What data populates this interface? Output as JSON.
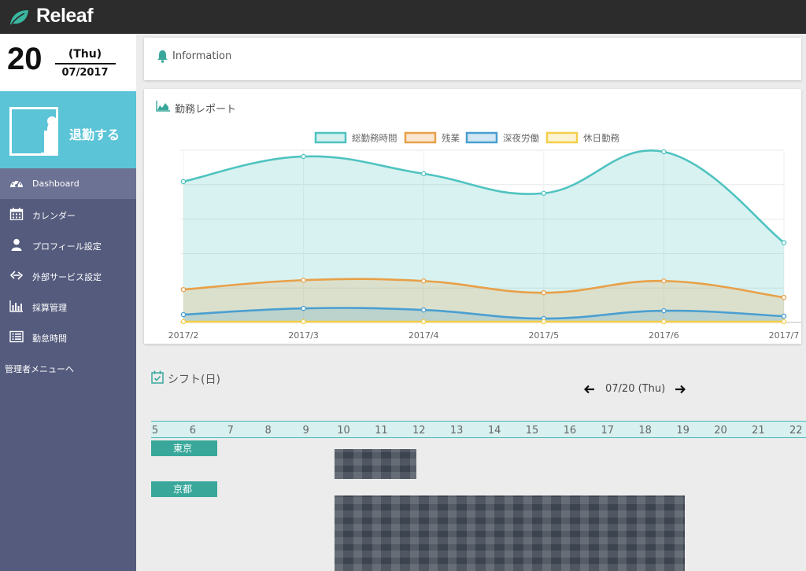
{
  "app": {
    "name": "Releaf"
  },
  "colors": {
    "topbar": "#2c2c2c",
    "sidebar": "#545b7d",
    "sidebar_active": "#6c7293",
    "accent": "#5bc4d6",
    "teal": "#39a89b"
  },
  "date": {
    "day": "20",
    "weekday": "(Thu)",
    "month_year": "07/2017"
  },
  "clock_button": {
    "label": "退勤する",
    "icon": "clock-card-icon"
  },
  "nav": {
    "items": [
      {
        "label": "Dashboard",
        "icon": "dashboard-icon",
        "active": true
      },
      {
        "label": "カレンダー",
        "icon": "calendar-icon",
        "active": false
      },
      {
        "label": "プロフィール設定",
        "icon": "user-icon",
        "active": false
      },
      {
        "label": "外部サービス設定",
        "icon": "link-icon",
        "active": false
      },
      {
        "label": "採算管理",
        "icon": "bar-chart-icon",
        "active": false
      },
      {
        "label": "勤怠時間",
        "icon": "list-icon",
        "active": false
      }
    ],
    "admin_link": "管理者メニューへ"
  },
  "info": {
    "title": "Information",
    "icon": "bell-icon"
  },
  "report": {
    "title": "勤務レポート",
    "icon": "area-chart-icon"
  },
  "chart_data": {
    "type": "area",
    "title": "",
    "x": [
      "2017/2",
      "2017/3",
      "2017/4",
      "2017/5",
      "2017/6",
      "2017/7"
    ],
    "ylim": [
      0,
      220
    ],
    "grid": true,
    "legend_position": "top",
    "series": [
      {
        "name": "総勤務時間",
        "color": "#4fc3c0",
        "values": [
          180,
          212,
          190,
          165,
          218,
          102
        ]
      },
      {
        "name": "残業",
        "color": "#e8a048",
        "values": [
          42,
          54,
          53,
          38,
          53,
          32
        ]
      },
      {
        "name": "深夜労働",
        "color": "#4a9fd0",
        "values": [
          10,
          18,
          16,
          5,
          15,
          8
        ]
      },
      {
        "name": "休日勤務",
        "color": "#f5cf4a",
        "values": [
          1,
          1,
          1,
          1,
          1,
          1
        ]
      }
    ]
  },
  "shift": {
    "title": "シフト(日)",
    "icon": "calendar-check-icon",
    "current_date": "07/20 (Thu)",
    "hours": [
      "5",
      "6",
      "7",
      "8",
      "9",
      "10",
      "11",
      "12",
      "13",
      "14",
      "15",
      "16",
      "17",
      "18",
      "19",
      "20",
      "21",
      "22"
    ],
    "locations": [
      "東京",
      "京都"
    ]
  }
}
